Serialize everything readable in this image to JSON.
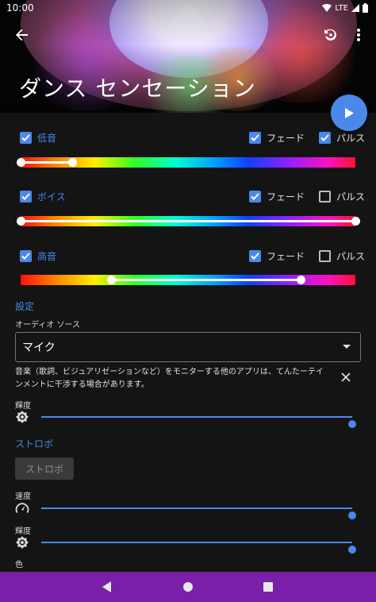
{
  "status_bar": {
    "time": "10:00",
    "network": "LTE"
  },
  "header": {
    "title": "ダンス センセーション"
  },
  "bands": [
    {
      "label": "低音",
      "fade_label": "フェード",
      "pulse_label": "パルス",
      "band_checked": true,
      "fade_checked": true,
      "pulse_checked": true,
      "range": [
        0.0,
        0.155
      ]
    },
    {
      "label": "ボイス",
      "fade_label": "フェード",
      "pulse_label": "パルス",
      "band_checked": true,
      "fade_checked": true,
      "pulse_checked": false,
      "range": [
        0.0,
        1.0
      ]
    },
    {
      "label": "高音",
      "fade_label": "フェード",
      "pulse_label": "パルス",
      "band_checked": true,
      "fade_checked": true,
      "pulse_checked": false,
      "range": [
        0.27,
        0.837
      ]
    }
  ],
  "settings": {
    "section_title": "設定",
    "audio_source_label": "オーディオ ソース",
    "audio_source_value": "マイク",
    "notice": "音楽（歌詞、ビジュアリゼーションなど）をモニターする他のアプリは、てんたーテインメントに干渉する場合があります。",
    "brightness_label": "輝度",
    "brightness_value": 1.0
  },
  "strobe": {
    "section_title": "ストロボ",
    "button_label": "ストロボ",
    "speed_label": "速度",
    "speed_value": 1.0,
    "brightness_label": "輝度",
    "brightness_value": 1.0,
    "color_label": "色"
  },
  "colors": {
    "accent": "#4a88ec",
    "nav_bar": "#7a1fa8"
  },
  "icons": [
    "back-arrow-icon",
    "restore-icon",
    "more-vert-icon",
    "play-icon",
    "check-icon",
    "brightness-icon",
    "speedometer-icon",
    "close-icon",
    "nav-back-icon",
    "nav-home-icon",
    "nav-recents-icon"
  ]
}
